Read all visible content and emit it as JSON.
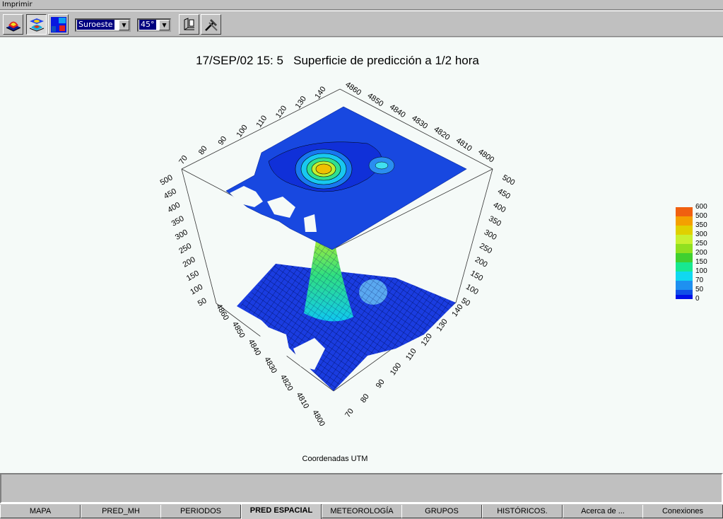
{
  "window": {
    "menu_label": "Imprimir"
  },
  "toolbar": {
    "icons": [
      "surface-3d-icon",
      "layered-contour-icon",
      "color-map-icon",
      "axis-frame-icon",
      "tools-icon"
    ],
    "direction_select": {
      "value": "Suroeste"
    },
    "angle_select": {
      "value": "45°"
    }
  },
  "chart": {
    "title": "17/SEP/02 15: 5   Superficie de predicción a 1/2 hora",
    "x_caption": "Coordenadas UTM"
  },
  "chart_data": {
    "type": "surface",
    "title": "17/SEP/02 15: 5   Superficie de predicción a 1/2 hora",
    "xlabel": "Coordenadas UTM",
    "x_ticks": [
      "70",
      "80",
      "90",
      "100",
      "110",
      "120",
      "130",
      "140"
    ],
    "y_ticks": [
      "4800",
      "4810",
      "4820",
      "4830",
      "4840",
      "4850",
      "4860"
    ],
    "z_ticks": [
      "50",
      "100",
      "150",
      "200",
      "250",
      "300",
      "350",
      "400",
      "450",
      "500"
    ],
    "xlim": [
      70,
      140
    ],
    "ylim": [
      4800,
      4860
    ],
    "zlim": [
      0,
      500
    ],
    "projection_view": "Suroeste 45°",
    "contour_plane": "top",
    "legend": {
      "placement": "right",
      "levels": [
        "600",
        "500",
        "350",
        "300",
        "250",
        "200",
        "150",
        "100",
        "70",
        "50",
        "0"
      ],
      "colors": [
        "#f06010",
        "#f4a000",
        "#e0d000",
        "#c8f030",
        "#90e020",
        "#40d030",
        "#18e890",
        "#10d8f0",
        "#1e90f0",
        "#1050e8",
        "#0010e8"
      ]
    }
  },
  "tabs": [
    {
      "label": "MAPA",
      "active": false
    },
    {
      "label": "PRED_MH",
      "active": false
    },
    {
      "label": "PERIODOS",
      "active": false
    },
    {
      "label": "PRED ESPACIAL",
      "active": true
    },
    {
      "label": "METEOROLOGÍA",
      "active": false
    },
    {
      "label": "GRUPOS",
      "active": false
    },
    {
      "label": "HISTÓRICOS.",
      "active": false
    },
    {
      "label": "Acerca de ...",
      "active": false
    },
    {
      "label": "Conexiones",
      "active": false
    }
  ]
}
